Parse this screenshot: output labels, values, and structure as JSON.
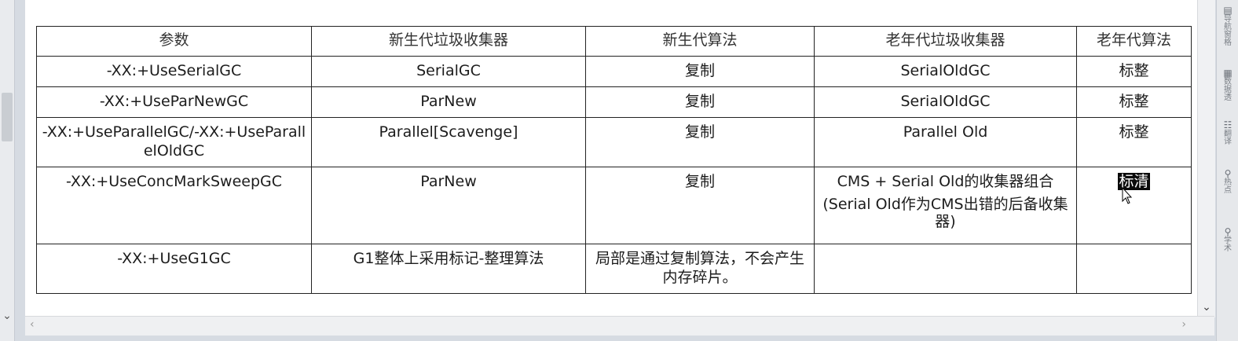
{
  "table": {
    "headers": [
      "参数",
      "新生代垃圾收集器",
      "新生代算法",
      "老年代垃圾收集器",
      "老年代算法"
    ],
    "rows": [
      {
        "param": "-XX:+UseSerialGC",
        "young_gc": "SerialGC",
        "young_algo": "复制",
        "old_gc": "SerialOldGC",
        "old_algo": "标整"
      },
      {
        "param": "-XX:+UseParNewGC",
        "young_gc": "ParNew",
        "young_algo": "复制",
        "old_gc": "SerialOldGC",
        "old_algo": "标整"
      },
      {
        "param": "-XX:+UseParallelGC/-XX:+UseParallelOldGC",
        "young_gc": "Parallel[Scavenge]",
        "young_algo": "复制",
        "old_gc": "Parallel Old",
        "old_algo": "标整"
      },
      {
        "param": "-XX:+UseConcMarkSweepGC",
        "young_gc": "ParNew",
        "young_algo": "复制",
        "old_gc": "CMS + Serial Old的收集器组合",
        "old_gc_note": "(Serial Old作为CMS出错的后备收集器)",
        "old_algo": "标清"
      },
      {
        "param": "-XX:+UseG1GC",
        "young_gc": "G1整体上采用标记-整理算法",
        "young_algo": "局部是通过复制算法，不会产生内存碎片。",
        "old_gc": "",
        "old_algo": ""
      }
    ]
  },
  "right_panel": {
    "items": [
      "导航窗格",
      "数据透",
      "翻译",
      "热点",
      "学术"
    ]
  },
  "icons": {
    "left_scroll_down": "chevron-down-icon",
    "right_scroll_down": "chevron-down-icon",
    "h_scroll_left": "chevron-left-icon",
    "h_scroll_right": "chevron-right-icon",
    "cursor": "mouse-cursor-icon"
  }
}
